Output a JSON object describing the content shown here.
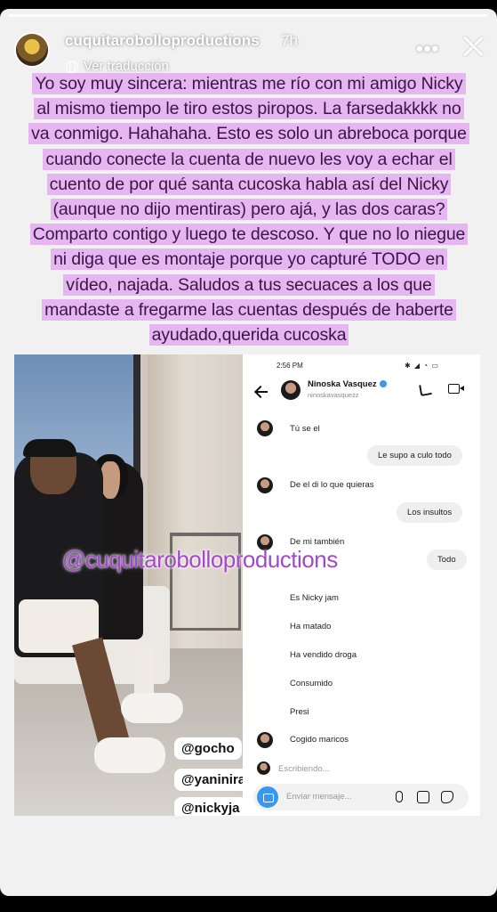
{
  "story": {
    "username": "cuquitarobolloproductions",
    "time": "7h",
    "translate_label": "Ver traducción",
    "more_icon": "more-horizontal-icon",
    "close_icon": "close-icon"
  },
  "caption": {
    "text": "Yo soy muy sincera: mientras me río con mi amigo Nicky al mismo tiempo le tiro estos piropos. La farsedakkkk no va conmigo. Hahahaha. Esto es solo un abreboca porque cuando conecte la cuenta de nuevo les voy a echar el cuento de por qué santa cucoska habla así del Nicky (aunque no dijo mentiras) pero ajá, y las dos caras? Comparto contigo y luego te descoso. Y que no lo niegue ni diga que es montaje porque yo capturé TODO en vídeo, najada. Saludos a tus secuaces a los que mandaste a fregarme las cuentas después de haberte ayudado,querida cucoska"
  },
  "photo": {
    "tags": [
      "@gocho",
      "@yaninira",
      "@nickyja"
    ]
  },
  "dm": {
    "status_time": "2:56 PM",
    "contact_name": "Ninoska Vasquez",
    "contact_handle": "ninoskavasquezz",
    "messages": [
      {
        "side": "in",
        "text": "Tú se el"
      },
      {
        "side": "out",
        "text": "Le supo a culo todo"
      },
      {
        "side": "in",
        "text": "De el di lo que quieras"
      },
      {
        "side": "out",
        "text": "Los insultos"
      },
      {
        "side": "in",
        "text": "De mi también"
      },
      {
        "side": "out",
        "text": "Todo"
      },
      {
        "side": "in",
        "text": "Es Nicky jam"
      },
      {
        "side": "in",
        "text": "Ha matado"
      },
      {
        "side": "in",
        "text": "Ha vendido droga"
      },
      {
        "side": "in",
        "text": "Consumido"
      },
      {
        "side": "in",
        "text": "Presi"
      },
      {
        "side": "in",
        "text": "Cogido maricos"
      }
    ],
    "typing": "Escribiendo...",
    "composer_placeholder": "Enviar mensaje..."
  },
  "watermark": "@cuquitarobolloproductions",
  "colors": {
    "caption_highlight": "#e5b6f0",
    "caption_text": "#3c1447",
    "watermark": "#a14ac9",
    "ig_blue": "#3897f0"
  }
}
